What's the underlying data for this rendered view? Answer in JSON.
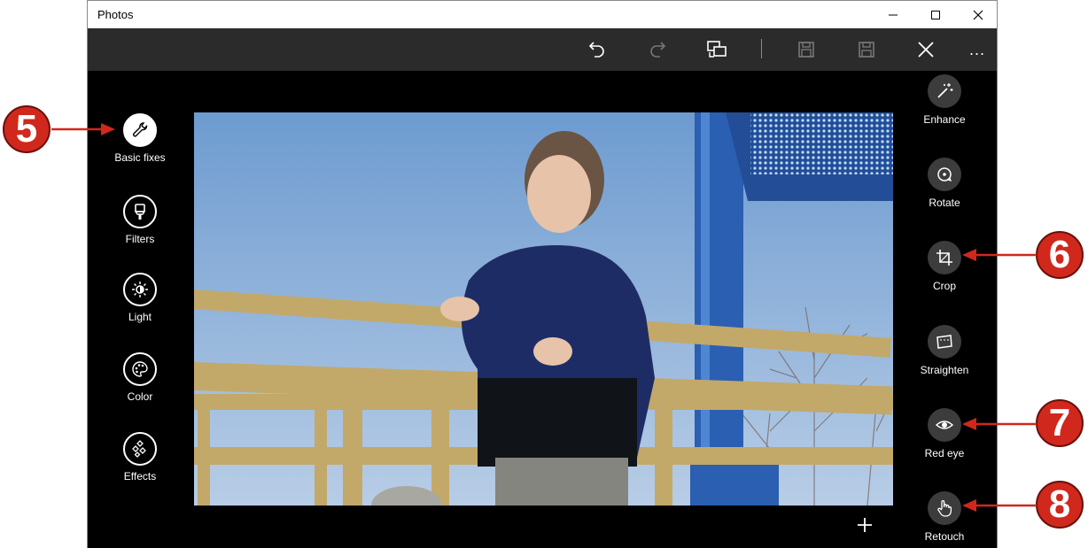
{
  "window": {
    "title": "Photos"
  },
  "toolbar": {
    "undo": "undo-icon",
    "redo": "redo-icon",
    "compare": "compare-icon",
    "save_copy": "save-copy-icon",
    "save": "save-icon",
    "cancel": "close-icon",
    "more": "..."
  },
  "left_tools": [
    {
      "label": "Basic fixes",
      "icon": "wrench-icon"
    },
    {
      "label": "Filters",
      "icon": "brush-icon"
    },
    {
      "label": "Light",
      "icon": "sun-icon"
    },
    {
      "label": "Color",
      "icon": "palette-icon"
    },
    {
      "label": "Effects",
      "icon": "effects-icon"
    }
  ],
  "right_tools": [
    {
      "label": "Enhance",
      "icon": "magic-wand-icon"
    },
    {
      "label": "Rotate",
      "icon": "rotate-icon"
    },
    {
      "label": "Crop",
      "icon": "crop-icon"
    },
    {
      "label": "Straighten",
      "icon": "straighten-icon"
    },
    {
      "label": "Red eye",
      "icon": "eye-icon"
    },
    {
      "label": "Retouch",
      "icon": "hand-icon"
    }
  ],
  "callouts": [
    "5",
    "6",
    "7",
    "8"
  ],
  "colors": {
    "callout": "#d0281d",
    "toolbar": "#2b2b2b",
    "canvas": "#000000"
  }
}
